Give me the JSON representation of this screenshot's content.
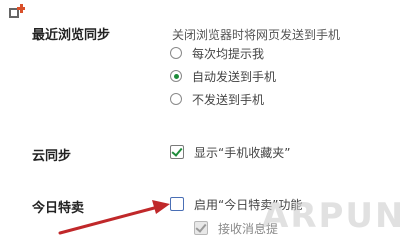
{
  "sections": {
    "recent_sync": {
      "title": "最近浏览同步",
      "description": "关闭浏览器时将网页发送到手机",
      "options": [
        {
          "label": "每次均提示我",
          "selected": false
        },
        {
          "label": "自动发送到手机",
          "selected": true
        },
        {
          "label": "不发送到手机",
          "selected": false
        }
      ]
    },
    "cloud_sync": {
      "title": "云同步",
      "checkbox_label": "显示“手机收藏夹”",
      "checked": true
    },
    "daily_deal": {
      "title": "今日特卖",
      "checkbox_label": "启用“今日特卖”功能",
      "checked": false,
      "sub_checkbox_label": "接收消息提",
      "sub_checked": true,
      "sub_disabled": true
    }
  },
  "watermark": "ARPUN",
  "colors": {
    "accent_green": "#1e8c3a",
    "arrow_red": "#c0282a",
    "icon_orange": "#d9502a"
  }
}
